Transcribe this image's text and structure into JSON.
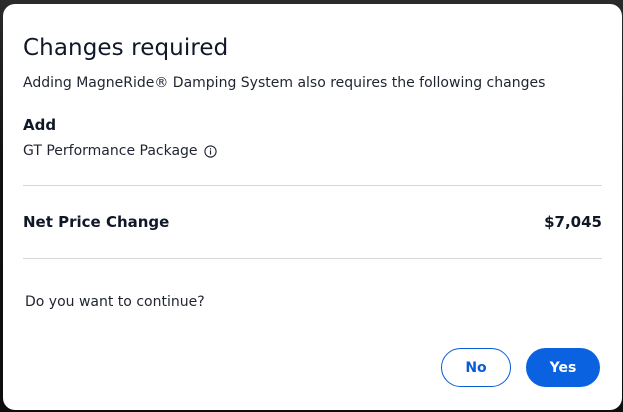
{
  "dialog": {
    "title": "Changes required",
    "subtitle": "Adding MagneRide® Damping System also requires the following changes",
    "add_heading": "Add",
    "added_item": "GT Performance Package",
    "added_item_icon": "info-icon",
    "net_price_label": "Net Price Change",
    "net_price_value": "$7,045",
    "question": "Do you want to continue?",
    "buttons": {
      "no_label": "No",
      "yes_label": "Yes"
    }
  },
  "colors": {
    "primary": "#0a62e0",
    "text": "#101828",
    "divider": "#d5d7dc",
    "backdrop": "#1b1b1b"
  }
}
